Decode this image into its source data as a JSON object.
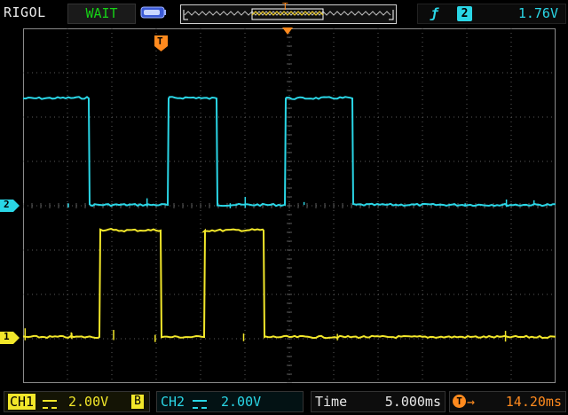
{
  "header": {
    "brand": "RIGOL",
    "run_status": "WAIT",
    "trigger": {
      "edge_symbol": "ƒ",
      "source": "2",
      "level": "1.76V"
    },
    "memory_marker": "T"
  },
  "screen": {
    "trigger_marker": "T",
    "ch2_marker": "2",
    "ch1_marker": "1"
  },
  "footer": {
    "ch1": {
      "label": "CH1",
      "scale": "2.00V",
      "bw_limit": "B"
    },
    "ch2": {
      "label": "CH2",
      "scale": "2.00V"
    },
    "time": {
      "label": "Time",
      "value": "5.000ms"
    },
    "delay": {
      "icon": "T",
      "arrow": "→",
      "value": "14.20ms"
    }
  },
  "colors": {
    "ch1": "#f2e72a",
    "ch2": "#2ad6e6",
    "trigger": "#ff8a1e",
    "grid": "#5a5a5a",
    "run_status": "#16d016"
  },
  "chart_data": {
    "type": "line",
    "x_unit": "ms",
    "x_per_div": 5.0,
    "y_per_div_v": 2.0,
    "x_divisions": 12,
    "y_divisions": 8,
    "series": [
      {
        "name": "CH2",
        "high_v": 4.8,
        "low_v": 0.0,
        "edges_ms": [
          -31.2,
          -22.6,
          -13.7,
          -8.2,
          -0.5,
          7.1
        ]
      },
      {
        "name": "CH1",
        "high_v": 4.8,
        "low_v": 0.0,
        "edges_ms": [
          -42.9,
          -32.6,
          -21.4,
          -14.5,
          -9.6,
          -2.9
        ]
      }
    ]
  }
}
